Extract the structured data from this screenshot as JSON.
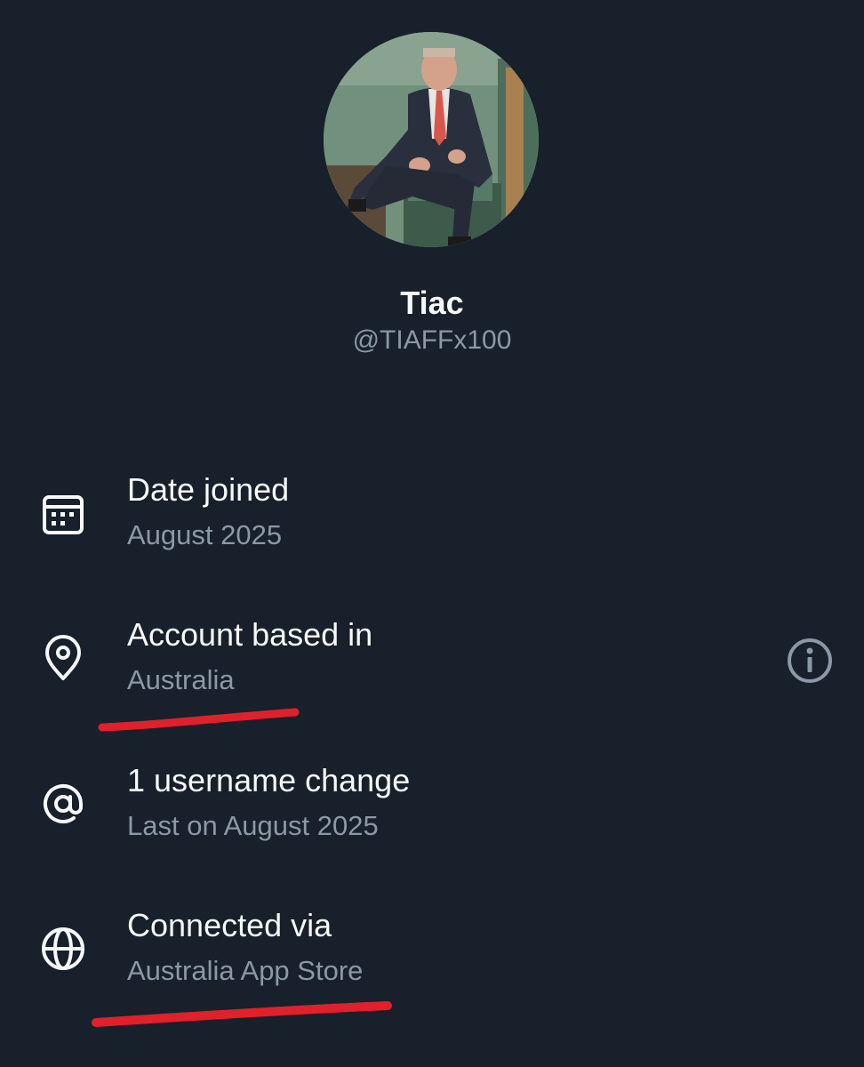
{
  "profile": {
    "display_name": "Tiac",
    "handle": "@TIAFFx100"
  },
  "details": {
    "date_joined": {
      "icon": "calendar-icon",
      "label": "Date joined",
      "value": "August 2025"
    },
    "account_based_in": {
      "icon": "location-pin-icon",
      "label": "Account based in",
      "value": "Australia",
      "info_icon": "info-icon"
    },
    "username_changes": {
      "icon": "at-sign-icon",
      "label": "1 username change",
      "value": "Last on August 2025"
    },
    "connected_via": {
      "icon": "globe-icon",
      "label": "Connected via",
      "value": "Australia App Store"
    }
  },
  "colors": {
    "background": "#17202b",
    "primary_text": "#f7f9f9",
    "secondary_text": "#8b98a5",
    "annotation_red": "#e0202a"
  }
}
